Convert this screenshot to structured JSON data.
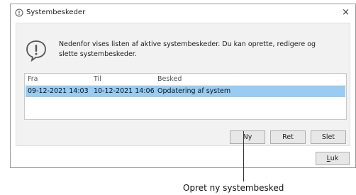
{
  "window": {
    "title": "Systembeskeder",
    "close_label": "×"
  },
  "info": {
    "message": "Nedenfor vises listen af aktive systembeskeder. Du kan oprette, redigere og slette systembeskeder."
  },
  "grid": {
    "columns": [
      "Fra",
      "Til",
      "Besked"
    ],
    "rows": [
      {
        "from": "09-12-2021 14:03",
        "to": "10-12-2021 14:06",
        "message": "Opdatering af system",
        "selected": true
      }
    ]
  },
  "buttons": {
    "new": "Ny",
    "edit": "Ret",
    "delete": "Slet",
    "close_prefix": "L",
    "close_rest": "uk"
  },
  "annotation": {
    "label": "Opret ny systembesked"
  },
  "colors": {
    "selection": "#99ccf3",
    "dialog_body": "#f2f2f2"
  },
  "icons": {
    "title": "notification-icon",
    "info": "exclamation-speech-bubble-icon"
  }
}
